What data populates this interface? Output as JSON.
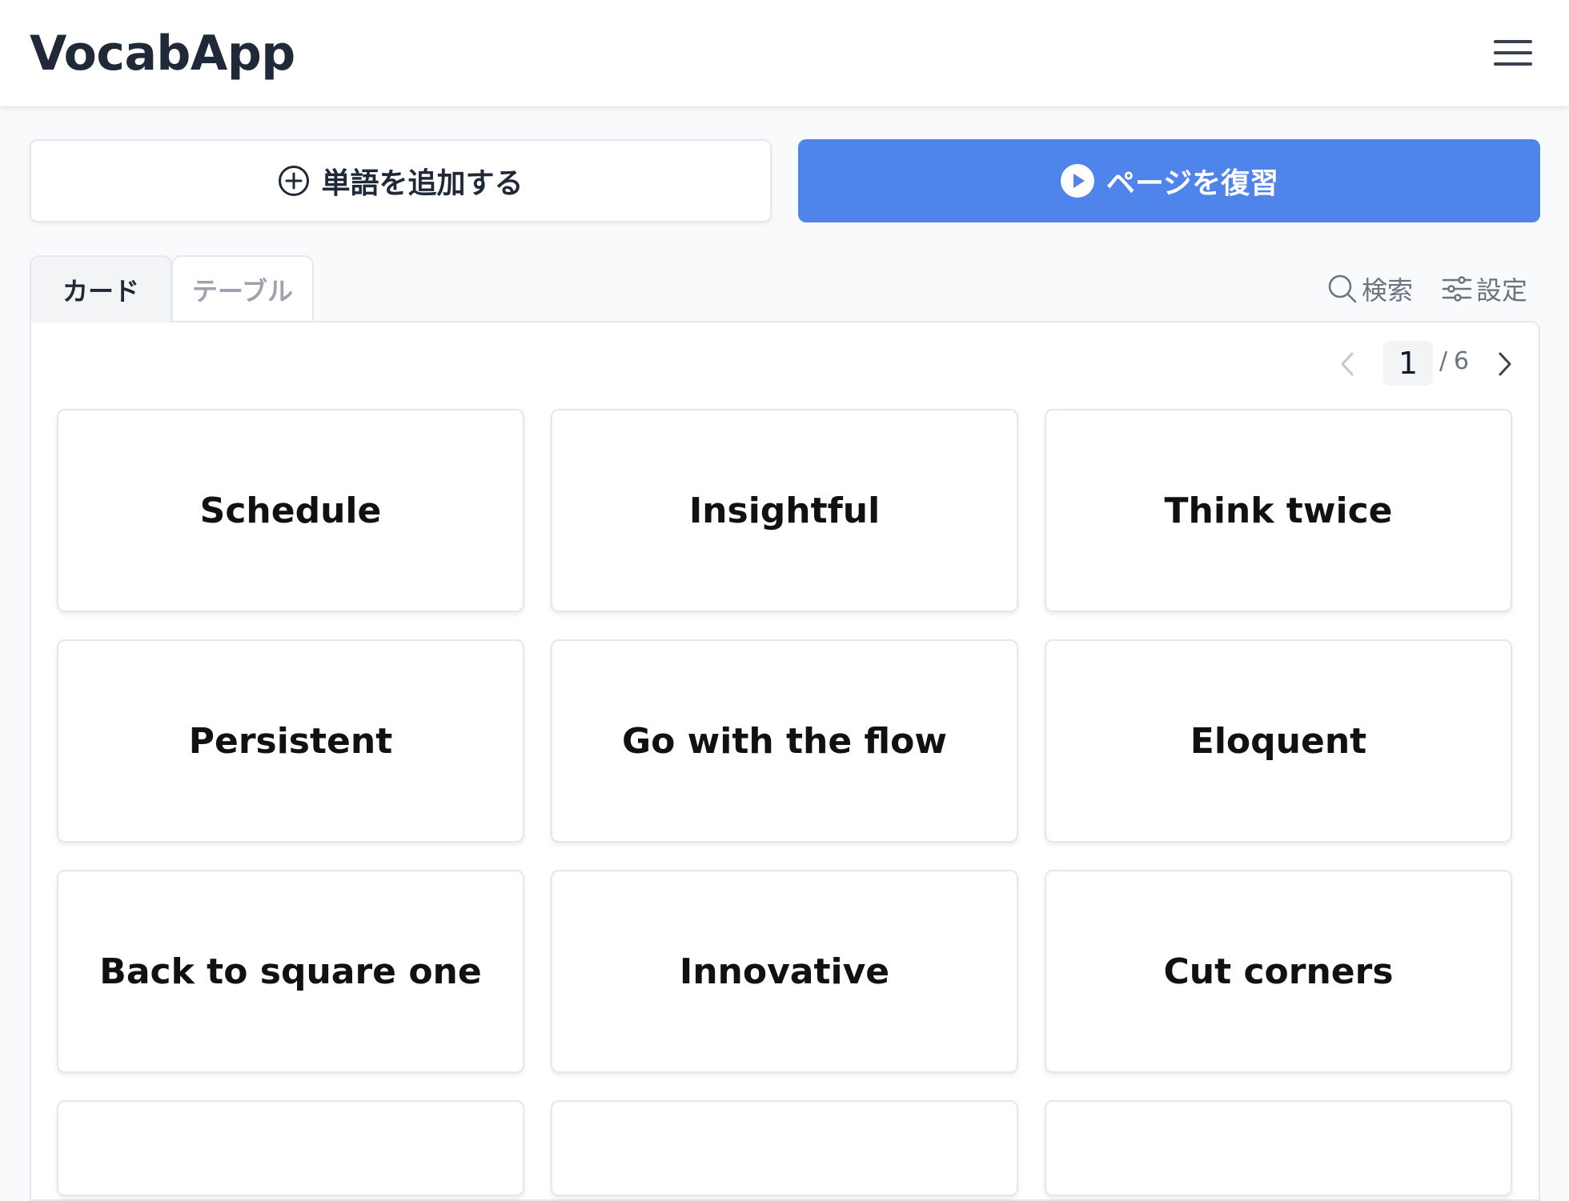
{
  "header": {
    "title": "VocabApp",
    "menu_icon": "hamburger-menu-icon"
  },
  "actions": {
    "add_word": "単語を追加する",
    "add_icon": "plus-circle-icon",
    "review_page": "ページを復習",
    "review_icon": "play-circle-icon"
  },
  "tabs": [
    {
      "label": "カード",
      "active": true
    },
    {
      "label": "テーブル",
      "active": false
    }
  ],
  "toolbar": {
    "search": "検索",
    "search_icon": "search-icon",
    "settings": "設定",
    "settings_icon": "sliders-icon"
  },
  "pagination": {
    "current": "1",
    "separator": "/",
    "total": "6"
  },
  "cards": [
    "Schedule",
    "Insightful",
    "Think twice",
    "Persistent",
    "Go with the flow",
    "Eloquent",
    "Back to square one",
    "Innovative",
    "Cut corners"
  ],
  "colors": {
    "accent": "#4f84ea",
    "title": "#1f2937",
    "muted": "#9ca3af",
    "border": "#e5e7eb"
  }
}
